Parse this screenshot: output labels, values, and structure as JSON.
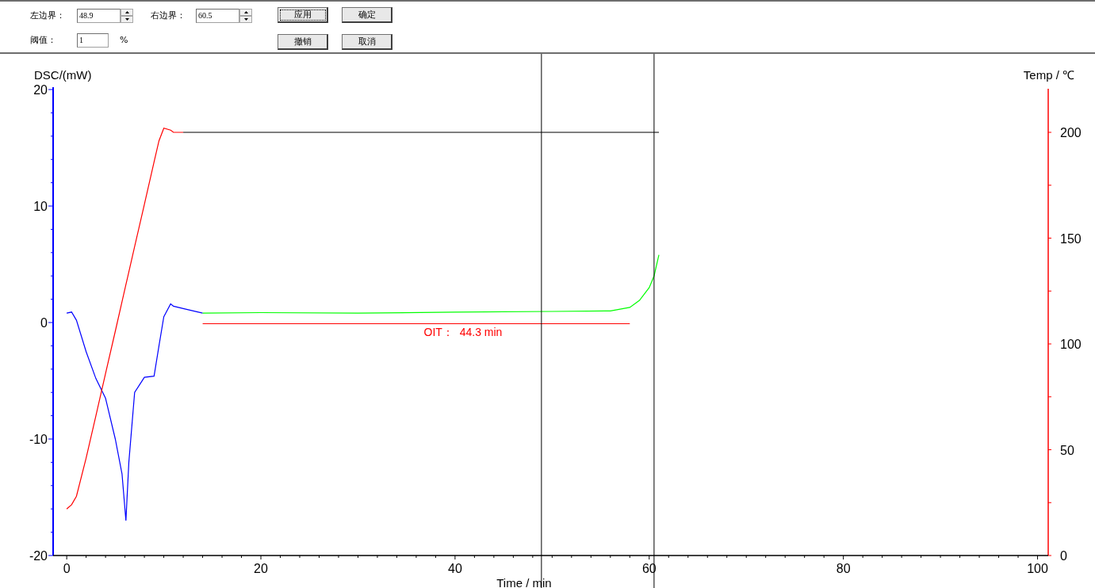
{
  "toolbar": {
    "left_bound": {
      "label": "左边界：",
      "value": "48.9"
    },
    "right_bound": {
      "label": "右边界：",
      "value": "60.5"
    },
    "threshold": {
      "label": "阈值：",
      "value": "1",
      "unit": "%"
    },
    "buttons": [
      {
        "label": "应用",
        "focused": true
      },
      {
        "label": "确定",
        "focused": false
      },
      {
        "label": "撤销",
        "focused": false
      },
      {
        "label": "取消",
        "focused": false
      }
    ]
  },
  "chart": {
    "chart_data": {
      "type": "line",
      "xlabel": "Time / min",
      "ylabel": "DSC/(mW)",
      "y2label": "Temp / ℃",
      "x": [
        0,
        0.5,
        1,
        2,
        3,
        4,
        5,
        5.7,
        6.1,
        6.4,
        7,
        8,
        9,
        9.5,
        10,
        10.7,
        11,
        12,
        14,
        20,
        30,
        40,
        50,
        56,
        58,
        59,
        60,
        60.5,
        61
      ],
      "series": [
        {
          "color": "#0000ff",
          "values": [
            0.8,
            0.9,
            0.2,
            -2.5,
            -4.8,
            -6.5,
            -10,
            -13,
            -17,
            -12,
            -6,
            -4.7,
            -4.6,
            -2,
            0.5,
            1.6,
            1.4,
            1.2,
            0.8,
            null,
            null,
            null,
            null,
            null,
            null,
            null,
            null,
            null,
            null
          ]
        },
        {
          "color": "#00ff00",
          "values": [
            null,
            null,
            null,
            null,
            null,
            null,
            null,
            null,
            null,
            null,
            null,
            null,
            null,
            null,
            null,
            null,
            null,
            null,
            0.8,
            0.85,
            0.8,
            0.9,
            0.95,
            1.0,
            1.3,
            1.9,
            3.0,
            4.0,
            5.8
          ]
        },
        {
          "color": "#ff0000",
          "axis": "y2",
          "values": [
            22,
            24,
            28,
            46,
            66,
            86,
            106,
            120,
            128,
            134,
            146,
            166,
            186,
            196,
            202,
            201,
            200,
            200,
            null,
            null,
            null,
            null,
            null,
            null,
            null,
            null,
            null,
            null,
            null
          ]
        },
        {
          "color": "#000000",
          "axis": "y2",
          "values": [
            null,
            null,
            null,
            null,
            null,
            null,
            null,
            null,
            null,
            null,
            null,
            null,
            null,
            null,
            null,
            null,
            null,
            200,
            200,
            200,
            200,
            200,
            200,
            200,
            200,
            200,
            200,
            200,
            200
          ]
        },
        {
          "color": "#ff0000",
          "values": [
            null,
            null,
            null,
            null,
            null,
            null,
            null,
            null,
            null,
            null,
            null,
            null,
            null,
            null,
            null,
            null,
            null,
            null,
            -0.1,
            -0.1,
            -0.1,
            -0.1,
            -0.1,
            -0.1,
            -0.1,
            null,
            null,
            null,
            null
          ]
        }
      ],
      "xlim": [
        -1.4,
        101.1
      ],
      "ylim": [
        -20,
        20
      ],
      "y2lim": [
        0,
        220
      ],
      "xticks": [
        0,
        20,
        40,
        60,
        80,
        100
      ],
      "yticks": [
        -20,
        -10,
        0,
        10,
        20
      ],
      "y2ticks": [
        0,
        50,
        100,
        150,
        200
      ],
      "annotations": [
        "OIT：  44.3 min"
      ],
      "ref_lines": [
        {
          "axis": "x",
          "value": 48.9
        },
        {
          "axis": "x",
          "value": 60.5
        }
      ]
    }
  }
}
